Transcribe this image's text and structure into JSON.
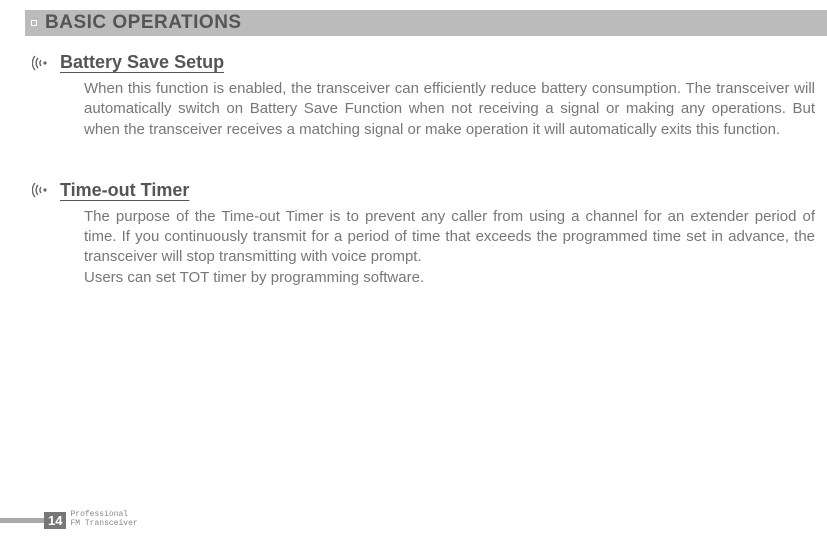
{
  "header": {
    "title": "BASIC OPERATIONS"
  },
  "sections": [
    {
      "title": "Battery Save Setup",
      "body": "When this function is enabled, the transceiver can efficiently reduce battery consumption. The transceiver will automatically switch on Battery Save Function when not receiving a signal or making any operations. But when the transceiver receives a matching signal or make operation it will automatically exits this function."
    },
    {
      "title": "Time-out Timer",
      "body": "The purpose of the Time-out Timer is to prevent any caller from using a channel for an extender period of time. If you continuously transmit for a period of time that exceeds the programmed time set in advance, the transceiver will stop transmitting with voice prompt.\nUsers can set TOT timer by programming software."
    }
  ],
  "footer": {
    "page": "14",
    "line1": "Professional",
    "line2": "FM Transceiver"
  }
}
